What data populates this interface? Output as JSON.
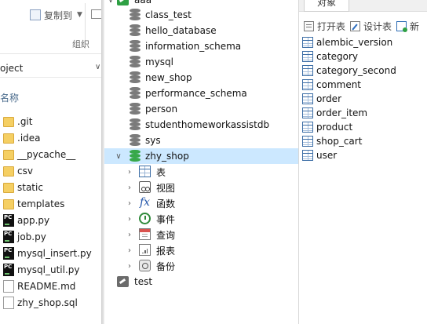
{
  "explorer": {
    "ribbon": {
      "copy_to_label": "复制到",
      "group_label": "组织"
    },
    "address": "oject",
    "column_header": "名称",
    "files": [
      {
        "name": ".git",
        "type": "folder"
      },
      {
        "name": ".idea",
        "type": "folder"
      },
      {
        "name": "__pycache__",
        "type": "folder"
      },
      {
        "name": "csv",
        "type": "folder"
      },
      {
        "name": "static",
        "type": "folder"
      },
      {
        "name": "templates",
        "type": "folder"
      },
      {
        "name": "app.py",
        "type": "python"
      },
      {
        "name": "job.py",
        "type": "python"
      },
      {
        "name": "mysql_insert.py",
        "type": "python"
      },
      {
        "name": "mysql_util.py",
        "type": "python"
      },
      {
        "name": "README.md",
        "type": "doc"
      },
      {
        "name": "zhy_shop.sql",
        "type": "doc"
      }
    ]
  },
  "tree": {
    "connection_top": "aaa",
    "databases": [
      "class_test",
      "hello_database",
      "information_schema",
      "mysql",
      "new_shop",
      "performance_schema",
      "person",
      "studenthomeworkassistdb",
      "sys"
    ],
    "open_database": "zhy_shop",
    "open_database_children": [
      {
        "label": "表",
        "icon": "table-icon"
      },
      {
        "label": "视图",
        "icon": "view-icon"
      },
      {
        "label": "函数",
        "icon": "function-icon"
      },
      {
        "label": "事件",
        "icon": "event-icon"
      },
      {
        "label": "查询",
        "icon": "query-icon"
      },
      {
        "label": "报表",
        "icon": "report-icon"
      },
      {
        "label": "备份",
        "icon": "backup-icon"
      }
    ],
    "connection_bottom": "test"
  },
  "objects": {
    "tab_label": "对象",
    "toolbar": {
      "open_table": "打开表",
      "design_table": "设计表",
      "new_table": "新"
    },
    "tables": [
      "alembic_version",
      "category",
      "category_second",
      "comment",
      "order",
      "order_item",
      "product",
      "shop_cart",
      "user"
    ]
  },
  "colors": {
    "selection": "#cce8ff",
    "db_open": "#37a84a",
    "db_closed": "#7b7b7b",
    "folder": "#f5cf63"
  }
}
